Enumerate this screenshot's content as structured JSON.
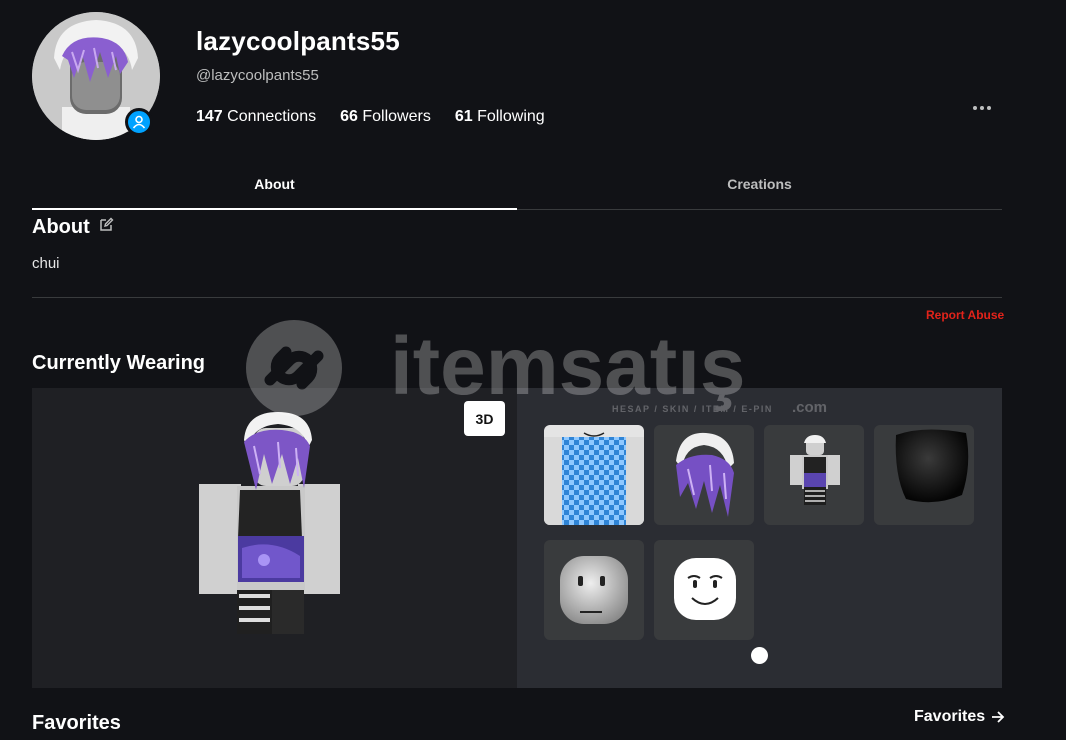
{
  "profile": {
    "display_name": "lazycoolpants55",
    "username": "@lazycoolpants55",
    "stats": [
      {
        "count": "147",
        "label": "Connections"
      },
      {
        "count": "66",
        "label": "Followers"
      },
      {
        "count": "61",
        "label": "Following"
      }
    ]
  },
  "tabs": [
    {
      "label": "About",
      "active": true
    },
    {
      "label": "Creations",
      "active": false
    }
  ],
  "about": {
    "heading": "About",
    "text": "chui",
    "report_label": "Report Abuse"
  },
  "watermark": {
    "brand": "itemsatış",
    "tagline": "HESAP / SKIN / ITEM / E-PIN",
    "suffix": ".com"
  },
  "wearing": {
    "heading": "Currently Wearing",
    "view_toggle": "3D",
    "items": [
      {
        "icon": "checkered-shirt-icon"
      },
      {
        "icon": "purple-hair-icon"
      },
      {
        "icon": "outfit-icon"
      },
      {
        "icon": "black-head-icon"
      },
      {
        "icon": "head-icon"
      },
      {
        "icon": "smile-face-icon"
      }
    ]
  },
  "favorites": {
    "heading": "Favorites",
    "link_label": "Favorites"
  },
  "colors": {
    "background": "#111216",
    "panel": "#1f2024",
    "items_panel": "#2b2d33",
    "accent_blue": "#00a2ff",
    "report_red": "#e2231a"
  }
}
